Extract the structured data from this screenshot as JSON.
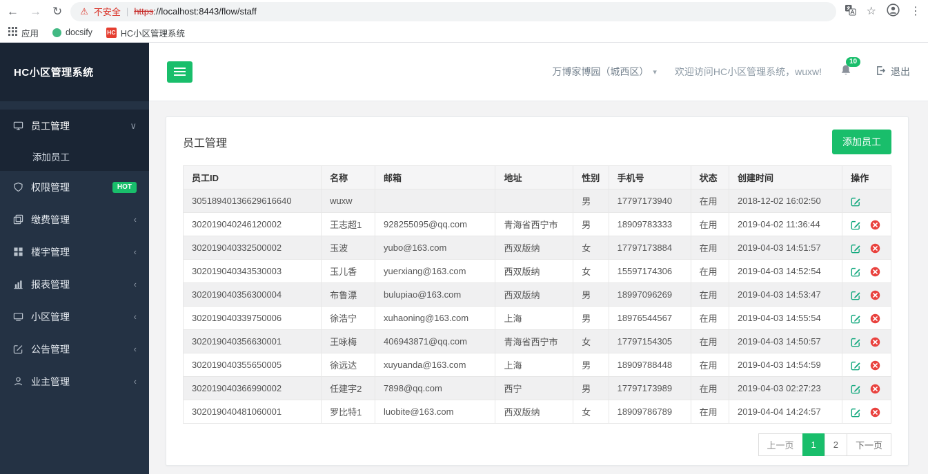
{
  "browser": {
    "security_warning": "不安全",
    "url_scheme": "https",
    "url_rest": "://localhost:8443/flow/staff",
    "bookmarks": {
      "apps_label": "应用",
      "docsify_label": "docsify",
      "hc_label": "HC小区管理系统",
      "hc_logo_text": "HC"
    }
  },
  "icons": {
    "back": "←",
    "forward": "→",
    "reload": "↻",
    "warning": "⚠",
    "star": "☆",
    "kebab": "⋮",
    "divider": "|",
    "caret_down": "▾",
    "chevron_down": "∨",
    "chevron_left": "‹"
  },
  "sidebar": {
    "title": "HC小区管理系统",
    "items": [
      {
        "label": "员工管理",
        "children": [
          {
            "label": "添加员工"
          }
        ]
      },
      {
        "label": "权限管理",
        "badge": "HOT"
      },
      {
        "label": "缴费管理"
      },
      {
        "label": "楼宇管理"
      },
      {
        "label": "报表管理"
      },
      {
        "label": "小区管理"
      },
      {
        "label": "公告管理"
      },
      {
        "label": "业主管理"
      }
    ]
  },
  "header": {
    "community_selector": "万博家博园（城西区）",
    "welcome": "欢迎访问HC小区管理系统，wuxw!",
    "notification_count": "10",
    "logout_label": "退出"
  },
  "main": {
    "page_title": "员工管理",
    "add_button_label": "添加员工",
    "table": {
      "columns": [
        "员工ID",
        "名称",
        "邮箱",
        "地址",
        "性别",
        "手机号",
        "状态",
        "创建时间",
        "操作"
      ],
      "rows": [
        {
          "id": "30518940136629616640",
          "name": "wuxw",
          "email": "",
          "address": "",
          "gender": "男",
          "phone": "17797173940",
          "status": "在用",
          "created": "2018-12-02 16:02:50",
          "can_delete": false
        },
        {
          "id": "302019040246120002",
          "name": "王志超1",
          "email": "928255095@qq.com",
          "address": "青海省西宁市",
          "gender": "男",
          "phone": "18909783333",
          "status": "在用",
          "created": "2019-04-02 11:36:44",
          "can_delete": true
        },
        {
          "id": "302019040332500002",
          "name": "玉波",
          "email": "yubo@163.com",
          "address": "西双版纳",
          "gender": "女",
          "phone": "17797173884",
          "status": "在用",
          "created": "2019-04-03 14:51:57",
          "can_delete": true
        },
        {
          "id": "302019040343530003",
          "name": "玉儿香",
          "email": "yuerxiang@163.com",
          "address": "西双版纳",
          "gender": "女",
          "phone": "15597174306",
          "status": "在用",
          "created": "2019-04-03 14:52:54",
          "can_delete": true
        },
        {
          "id": "302019040356300004",
          "name": "布鲁漂",
          "email": "bulupiao@163.com",
          "address": "西双版纳",
          "gender": "男",
          "phone": "18997096269",
          "status": "在用",
          "created": "2019-04-03 14:53:47",
          "can_delete": true
        },
        {
          "id": "302019040339750006",
          "name": "徐浩宁",
          "email": "xuhaoning@163.com",
          "address": "上海",
          "gender": "男",
          "phone": "18976544567",
          "status": "在用",
          "created": "2019-04-03 14:55:54",
          "can_delete": true
        },
        {
          "id": "302019040356630001",
          "name": "王咏梅",
          "email": "406943871@qq.com",
          "address": "青海省西宁市",
          "gender": "女",
          "phone": "17797154305",
          "status": "在用",
          "created": "2019-04-03 14:50:57",
          "can_delete": true
        },
        {
          "id": "302019040355650005",
          "name": "徐远达",
          "email": "xuyuanda@163.com",
          "address": "上海",
          "gender": "男",
          "phone": "18909788448",
          "status": "在用",
          "created": "2019-04-03 14:54:59",
          "can_delete": true
        },
        {
          "id": "302019040366990002",
          "name": "任建宇2",
          "email": "7898@qq.com",
          "address": "西宁",
          "gender": "男",
          "phone": "17797173989",
          "status": "在用",
          "created": "2019-04-03 02:27:23",
          "can_delete": true
        },
        {
          "id": "302019040481060001",
          "name": "罗比特1",
          "email": "luobite@163.com",
          "address": "西双版纳",
          "gender": "女",
          "phone": "18909786789",
          "status": "在用",
          "created": "2019-04-04 14:24:57",
          "can_delete": true
        }
      ]
    },
    "pagination": {
      "prev_label": "上一页",
      "pages": [
        "1",
        "2"
      ],
      "active_page": "1",
      "next_label": "下一页"
    }
  },
  "colors": {
    "accent_green": "#19be6b",
    "danger_red": "#e9423e",
    "sidebar_bg": "#243244",
    "sidebar_dark": "#1a2534"
  }
}
